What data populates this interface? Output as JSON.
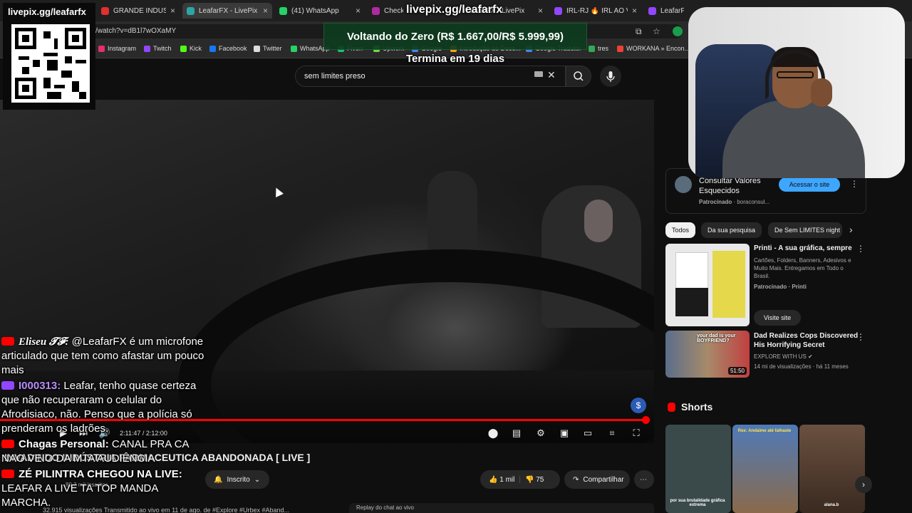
{
  "browser": {
    "tabs": [
      {
        "label": "GRANDE INDUSTRIA",
        "color": "#e03030"
      },
      {
        "label": "LeafarFX - LivePix",
        "color": "#2aa6a6"
      },
      {
        "label": "(41) WhatsApp",
        "color": "#25d366"
      },
      {
        "label": "Checkout",
        "color": "#b02aa0"
      },
      {
        "label": "LeafarFX - LivePix",
        "color": "#2aa6a6"
      },
      {
        "label": "IRL-RJ 🔥 IRL AO VIVO",
        "color": "#9146ff"
      },
      {
        "label": "LeafarFX - Twitch",
        "color": "#9146ff"
      }
    ],
    "url": "/watch?v=dB1l7wOXaMY",
    "bookmarks": [
      {
        "label": "Instagram",
        "color": "#e1306c"
      },
      {
        "label": "Twitch",
        "color": "#9146ff"
      },
      {
        "label": "Kick",
        "color": "#53fc18"
      },
      {
        "label": "Facebook",
        "color": "#1877f2"
      },
      {
        "label": "Twitter",
        "color": "#dddddd"
      },
      {
        "label": "WhatsApp",
        "color": "#25d366"
      },
      {
        "label": "Fiverr",
        "color": "#1dbf73"
      },
      {
        "label": "Upwork",
        "color": "#6fda44"
      },
      {
        "label": "Google",
        "color": "#4285f4"
      },
      {
        "label": "Introdução ao Dese...",
        "color": "#ff9f1a"
      },
      {
        "label": "Google Tradutor",
        "color": "#4285f4"
      },
      {
        "label": "tres",
        "color": "#34a853"
      },
      {
        "label": "WORKANA » Encon...",
        "color": "#ea4335"
      }
    ]
  },
  "youtube": {
    "search_query": "sem limites preso",
    "video": {
      "title": "INVADINDO INDÚSTRIA FARMACEUTICA ABANDONADA [ LIVE ]",
      "progress": 0.995,
      "time": "2:11:47 / 2:12:00"
    },
    "channel": {
      "subscribers": "80,3 mil inscritos",
      "subscribed_label": "Inscrito"
    },
    "actions": {
      "likes": "1 mil",
      "dislikes": "75",
      "share_label": "Compartilhar"
    },
    "views_line": "32.915 visualizações  Transmitido ao vivo em 11 de ago. de  #Explore #Urbex #Aband...",
    "chat_reply": "Replay do chat ao vivo",
    "sidebar": {
      "ad": {
        "title": "Consultar Valores Esquecidos",
        "sponsored": "Patrocinado",
        "domain": "boraconsul...",
        "button": "Acessar o site"
      },
      "chips": [
        "Todos",
        "Da sua pesquisa",
        "De Sem LIMITES night"
      ],
      "reco": [
        {
          "title": "Printi - A sua gráfica, sempre",
          "desc": "Cartões, Folders, Banners, Adesivos e Muito Mais. Entregamos em Todo o Brasil.",
          "channel": "Patrocinado · Printi",
          "button": "Visite site"
        },
        {
          "title": "Dad Realizes Cops Discovered His Horrifying Secret",
          "channel": "EXPLORE WITH US",
          "meta": "14 mi de visualizações · há 11 meses",
          "duration": "51:50",
          "thumb_text": "your dad is your BOYFRIEND?"
        }
      ],
      "shorts_label": "Shorts",
      "shorts": [
        {
          "caption": "por sua brutalidade gráfica extrema",
          "color": "#3a4a4a"
        },
        {
          "caption": "Rex: Andaime até falhaste",
          "color": "#4f7ab8"
        },
        {
          "caption": "alana.b",
          "color": "#5a4030"
        }
      ]
    }
  },
  "overlay": {
    "livepix_left": "livepix.gg/leafarfx",
    "livepix_top": "livepix.gg/leafarfx",
    "goal": "Voltando do Zero (R$ 1.667,00/R$ 5.999,99)",
    "goal_ends": "Termina em 19 dias"
  },
  "chat": [
    {
      "platform": "youtube",
      "user": "Eliseu 𝓣𝓕:",
      "text": "@LeafarFX é um microfone articulado que tem como afastar um pouco mais"
    },
    {
      "platform": "twitch",
      "user": "I000313:",
      "text": "Leafar, tenho quase certeza que não recuperaram o celular do Afrodisiaco, não. Penso que a polícia só prenderam os ladrões."
    },
    {
      "platform": "youtube",
      "user": "Chagas Personal:",
      "text": "CANAL PRA CA NAO VEIO DA MTA AUDIÊNCIA"
    },
    {
      "platform": "youtube",
      "user": "ZÉ PILINTRA CHEGOU NA LIVE:",
      "text": "LEAFAR A LIVE TA TOP MANDA MARCHA."
    }
  ]
}
